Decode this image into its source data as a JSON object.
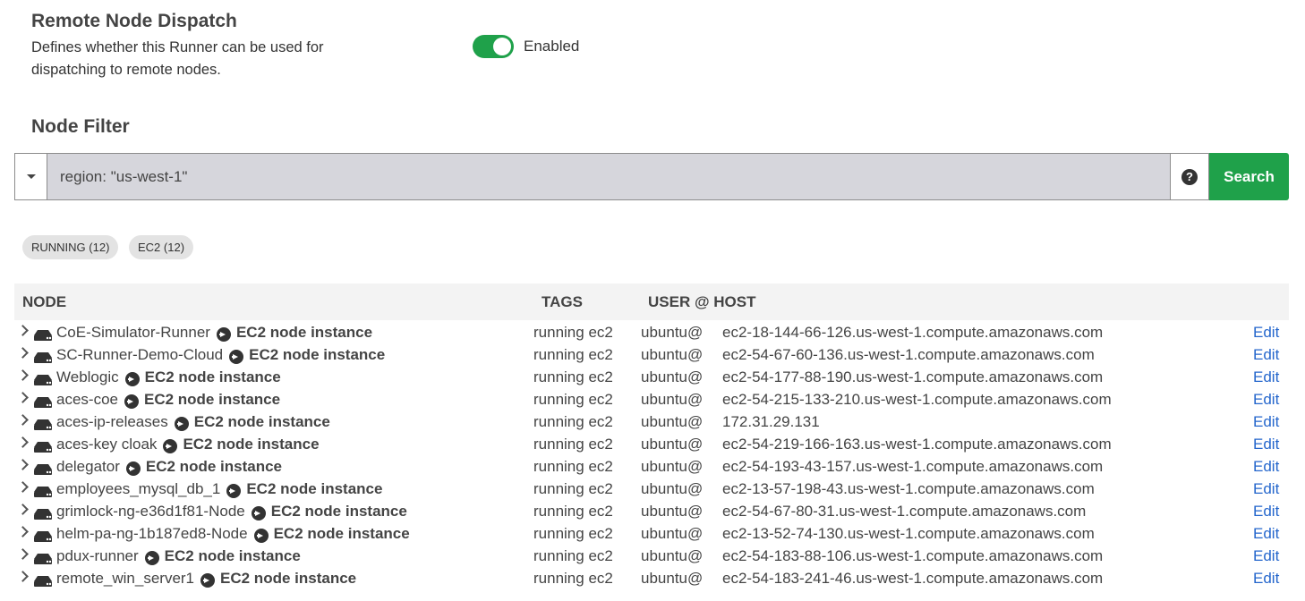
{
  "dispatch": {
    "title": "Remote Node Dispatch",
    "description": "Defines whether this Runner can be used for dispatching to remote nodes.",
    "toggle_label": "Enabled"
  },
  "filter": {
    "title": "Node Filter",
    "value": "region: \"us-west-1\"",
    "search_label": "Search",
    "help_glyph": "?"
  },
  "chips": [
    "RUNNING (12)",
    "EC2 (12)"
  ],
  "table": {
    "headers": {
      "node": "NODE",
      "tags": "TAGS",
      "userhost": "USER @ HOST"
    },
    "instance_label": "EC2 node instance",
    "tag1": "running",
    "tag2": "ec2",
    "user": "ubuntu@",
    "edit_label": "Edit",
    "rows": [
      {
        "name": "CoE-Simulator-Runner",
        "host": "ec2-18-144-66-126.us-west-1.compute.amazonaws.com"
      },
      {
        "name": "SC-Runner-Demo-Cloud",
        "host": "ec2-54-67-60-136.us-west-1.compute.amazonaws.com"
      },
      {
        "name": "Weblogic",
        "host": "ec2-54-177-88-190.us-west-1.compute.amazonaws.com"
      },
      {
        "name": "aces-coe",
        "host": "ec2-54-215-133-210.us-west-1.compute.amazonaws.com"
      },
      {
        "name": "aces-ip-releases",
        "host": "172.31.29.131"
      },
      {
        "name": "aces-key cloak",
        "host": "ec2-54-219-166-163.us-west-1.compute.amazonaws.com"
      },
      {
        "name": "delegator",
        "host": "ec2-54-193-43-157.us-west-1.compute.amazonaws.com"
      },
      {
        "name": "employees_mysql_db_1",
        "host": "ec2-13-57-198-43.us-west-1.compute.amazonaws.com"
      },
      {
        "name": "grimlock-ng-e36d1f81-Node",
        "host": "ec2-54-67-80-31.us-west-1.compute.amazonaws.com"
      },
      {
        "name": "helm-pa-ng-1b187ed8-Node",
        "host": "ec2-13-52-74-130.us-west-1.compute.amazonaws.com"
      },
      {
        "name": "pdux-runner",
        "host": "ec2-54-183-88-106.us-west-1.compute.amazonaws.com"
      },
      {
        "name": "remote_win_server1",
        "host": "ec2-54-183-241-46.us-west-1.compute.amazonaws.com"
      }
    ]
  }
}
